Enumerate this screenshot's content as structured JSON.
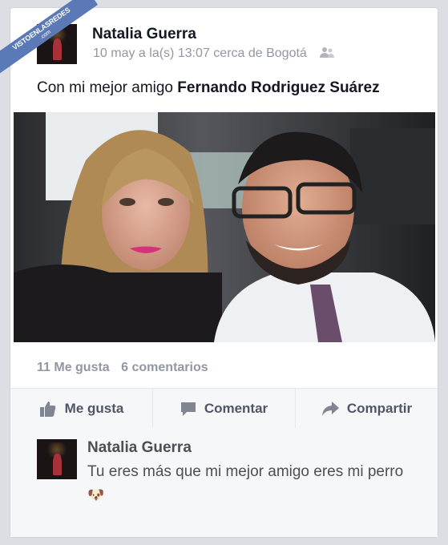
{
  "watermark": {
    "line1": "VISTOENLASREDES",
    "line2": ".com"
  },
  "post": {
    "author": "Natalia Guerra",
    "timestamp": "10 may a la(s) 13:07 cerca de Bogotá",
    "audience_icon": "friends-icon",
    "text_prefix": "Con mi mejor amigo ",
    "tagged": "Fernando Rodriguez Suárez",
    "likes": "11 Me gusta",
    "comments": "6 comentarios"
  },
  "actions": {
    "like": "Me gusta",
    "comment": "Comentar",
    "share": "Compartir"
  },
  "comment": {
    "author": "Natalia Guerra",
    "text": "Tu eres más que mi mejor amigo eres mi perro",
    "emoji": "🐶"
  },
  "colors": {
    "brand": "#3b5998",
    "secondary_text": "#9197a3",
    "action_text": "#4e5665"
  }
}
